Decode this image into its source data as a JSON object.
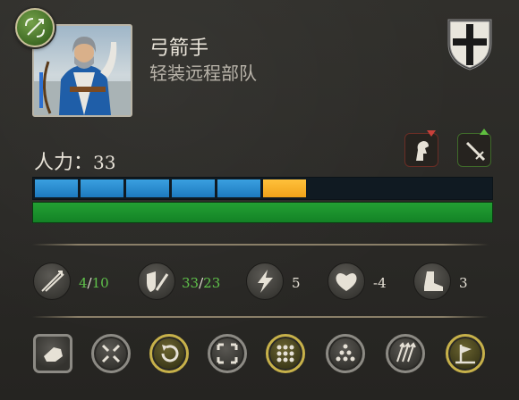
{
  "unit": {
    "name": "弓箭手",
    "class": "轻装远程部队"
  },
  "manpower": {
    "label": "人力：",
    "value": "33",
    "bar_segments": [
      "blue",
      "blue",
      "blue",
      "blue",
      "blue",
      "yellow"
    ],
    "health_fraction": 1.0
  },
  "stats": [
    {
      "name": "ammo",
      "icon": "arrows-icon",
      "current": "4",
      "sep": "/",
      "max": "10"
    },
    {
      "name": "melee",
      "icon": "shield-sword-icon",
      "current": "33",
      "sep": "/",
      "max": "23"
    },
    {
      "name": "charge",
      "icon": "lightning-icon",
      "value": "5"
    },
    {
      "name": "morale",
      "icon": "heart-icon",
      "value": "-4"
    },
    {
      "name": "speed",
      "icon": "boot-icon",
      "value": "3"
    }
  ],
  "colors": {
    "bar_blue": "#1d79bf",
    "bar_yellow": "#f0a21a",
    "health_green": "#138226",
    "stat_green": "#5fc14a",
    "gold_ring": "#c7b14a",
    "silver_ring": "#8c8a84"
  },
  "commands": [
    {
      "name": "charge-cmd",
      "icon": "hand-icon",
      "style": "square"
    },
    {
      "name": "tighten-formation-cmd",
      "icon": "compress-arrows-icon",
      "style": "silver"
    },
    {
      "name": "rotate-cmd",
      "icon": "rotate-icon",
      "style": "gold"
    },
    {
      "name": "loose-formation-cmd",
      "icon": "expand-arrows-icon",
      "style": "silver"
    },
    {
      "name": "square-formation-cmd",
      "icon": "grid-dots-icon",
      "style": "gold"
    },
    {
      "name": "wedge-formation-cmd",
      "icon": "triangle-dots-icon",
      "style": "silver"
    },
    {
      "name": "fire-at-will-cmd",
      "icon": "volley-arrows-icon",
      "style": "silver"
    },
    {
      "name": "hold-position-cmd",
      "icon": "flag-icon",
      "style": "gold"
    }
  ]
}
